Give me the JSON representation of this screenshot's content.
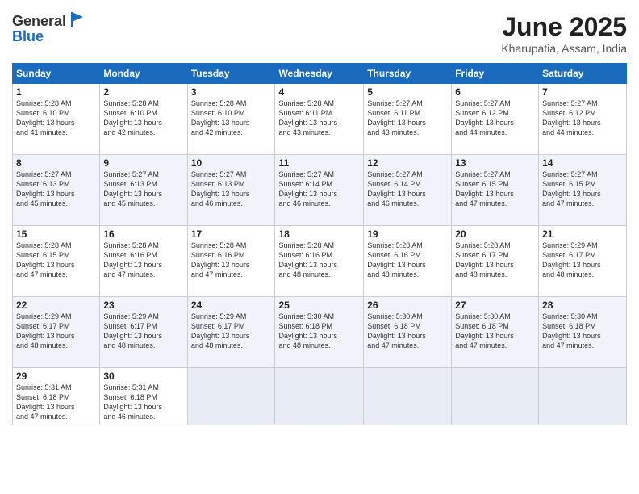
{
  "header": {
    "logo_line1": "General",
    "logo_line2": "Blue",
    "title": "June 2025",
    "subtitle": "Kharupatia, Assam, India"
  },
  "columns": [
    "Sunday",
    "Monday",
    "Tuesday",
    "Wednesday",
    "Thursday",
    "Friday",
    "Saturday"
  ],
  "weeks": [
    [
      {
        "day": "1",
        "sunrise": "5:28 AM",
        "sunset": "6:10 PM",
        "daylight": "13 hours and 41 minutes."
      },
      {
        "day": "2",
        "sunrise": "5:28 AM",
        "sunset": "6:10 PM",
        "daylight": "13 hours and 42 minutes."
      },
      {
        "day": "3",
        "sunrise": "5:28 AM",
        "sunset": "6:10 PM",
        "daylight": "13 hours and 42 minutes."
      },
      {
        "day": "4",
        "sunrise": "5:28 AM",
        "sunset": "6:11 PM",
        "daylight": "13 hours and 43 minutes."
      },
      {
        "day": "5",
        "sunrise": "5:27 AM",
        "sunset": "6:11 PM",
        "daylight": "13 hours and 43 minutes."
      },
      {
        "day": "6",
        "sunrise": "5:27 AM",
        "sunset": "6:12 PM",
        "daylight": "13 hours and 44 minutes."
      },
      {
        "day": "7",
        "sunrise": "5:27 AM",
        "sunset": "6:12 PM",
        "daylight": "13 hours and 44 minutes."
      }
    ],
    [
      {
        "day": "8",
        "sunrise": "5:27 AM",
        "sunset": "6:13 PM",
        "daylight": "13 hours and 45 minutes."
      },
      {
        "day": "9",
        "sunrise": "5:27 AM",
        "sunset": "6:13 PM",
        "daylight": "13 hours and 45 minutes."
      },
      {
        "day": "10",
        "sunrise": "5:27 AM",
        "sunset": "6:13 PM",
        "daylight": "13 hours and 46 minutes."
      },
      {
        "day": "11",
        "sunrise": "5:27 AM",
        "sunset": "6:14 PM",
        "daylight": "13 hours and 46 minutes."
      },
      {
        "day": "12",
        "sunrise": "5:27 AM",
        "sunset": "6:14 PM",
        "daylight": "13 hours and 46 minutes."
      },
      {
        "day": "13",
        "sunrise": "5:27 AM",
        "sunset": "6:15 PM",
        "daylight": "13 hours and 47 minutes."
      },
      {
        "day": "14",
        "sunrise": "5:27 AM",
        "sunset": "6:15 PM",
        "daylight": "13 hours and 47 minutes."
      }
    ],
    [
      {
        "day": "15",
        "sunrise": "5:28 AM",
        "sunset": "6:15 PM",
        "daylight": "13 hours and 47 minutes."
      },
      {
        "day": "16",
        "sunrise": "5:28 AM",
        "sunset": "6:16 PM",
        "daylight": "13 hours and 47 minutes."
      },
      {
        "day": "17",
        "sunrise": "5:28 AM",
        "sunset": "6:16 PM",
        "daylight": "13 hours and 47 minutes."
      },
      {
        "day": "18",
        "sunrise": "5:28 AM",
        "sunset": "6:16 PM",
        "daylight": "13 hours and 48 minutes."
      },
      {
        "day": "19",
        "sunrise": "5:28 AM",
        "sunset": "6:16 PM",
        "daylight": "13 hours and 48 minutes."
      },
      {
        "day": "20",
        "sunrise": "5:28 AM",
        "sunset": "6:17 PM",
        "daylight": "13 hours and 48 minutes."
      },
      {
        "day": "21",
        "sunrise": "5:29 AM",
        "sunset": "6:17 PM",
        "daylight": "13 hours and 48 minutes."
      }
    ],
    [
      {
        "day": "22",
        "sunrise": "5:29 AM",
        "sunset": "6:17 PM",
        "daylight": "13 hours and 48 minutes."
      },
      {
        "day": "23",
        "sunrise": "5:29 AM",
        "sunset": "6:17 PM",
        "daylight": "13 hours and 48 minutes."
      },
      {
        "day": "24",
        "sunrise": "5:29 AM",
        "sunset": "6:17 PM",
        "daylight": "13 hours and 48 minutes."
      },
      {
        "day": "25",
        "sunrise": "5:30 AM",
        "sunset": "6:18 PM",
        "daylight": "13 hours and 48 minutes."
      },
      {
        "day": "26",
        "sunrise": "5:30 AM",
        "sunset": "6:18 PM",
        "daylight": "13 hours and 47 minutes."
      },
      {
        "day": "27",
        "sunrise": "5:30 AM",
        "sunset": "6:18 PM",
        "daylight": "13 hours and 47 minutes."
      },
      {
        "day": "28",
        "sunrise": "5:30 AM",
        "sunset": "6:18 PM",
        "daylight": "13 hours and 47 minutes."
      }
    ],
    [
      {
        "day": "29",
        "sunrise": "5:31 AM",
        "sunset": "6:18 PM",
        "daylight": "13 hours and 47 minutes."
      },
      {
        "day": "30",
        "sunrise": "5:31 AM",
        "sunset": "6:18 PM",
        "daylight": "13 hours and 46 minutes."
      },
      null,
      null,
      null,
      null,
      null
    ]
  ]
}
